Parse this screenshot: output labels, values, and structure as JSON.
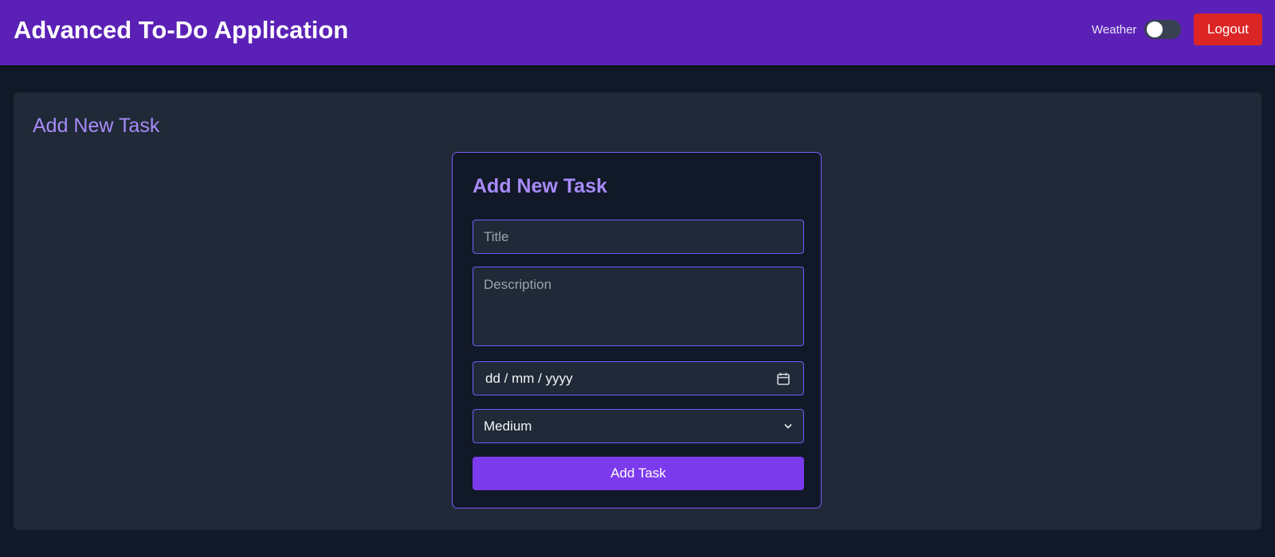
{
  "header": {
    "title": "Advanced To-Do Application",
    "weather_label": "Weather",
    "weather_toggle_on": false,
    "logout_label": "Logout"
  },
  "panel": {
    "heading": "Add New Task"
  },
  "form": {
    "heading": "Add New Task",
    "title_placeholder": "Title",
    "title_value": "",
    "description_placeholder": "Description",
    "description_value": "",
    "date_placeholder": "dd / mm / yyyy",
    "calendar_icon": "calendar-icon",
    "priority_selected": "Medium",
    "priority_icon": "chevron-down-icon",
    "submit_label": "Add Task"
  },
  "colors": {
    "header_bg": "#5b21b6",
    "page_bg": "#111827",
    "panel_bg": "#1f2937",
    "accent": "#a78bfa",
    "primary_button": "#7c3aed",
    "logout_button": "#dc2626",
    "field_border": "#6d5dfc"
  }
}
